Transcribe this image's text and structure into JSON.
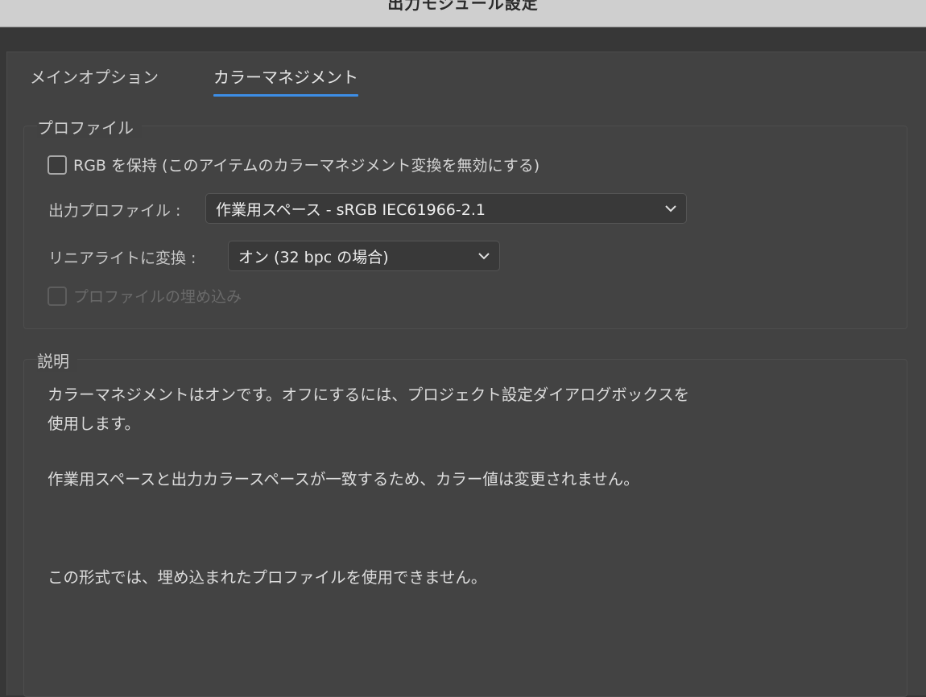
{
  "window": {
    "title": "出力モジュール設定"
  },
  "tabs": [
    {
      "label": "メインオプション",
      "active": false
    },
    {
      "label": "カラーマネジメント",
      "active": true
    }
  ],
  "profile_group": {
    "legend": "プロファイル",
    "preserve_rgb": {
      "label": "RGB を保持 (このアイテムのカラーマネジメント変換を無効にする)",
      "checked": false
    },
    "output_profile": {
      "label": "出力プロファイル :",
      "value": "作業用スペース - sRGB IEC61966-2.1"
    },
    "linear_light": {
      "label": "リニアライトに変換 :",
      "value": "オン (32 bpc の場合)"
    },
    "embed_profile": {
      "label": "プロファイルの埋め込み",
      "checked": false,
      "disabled": true
    }
  },
  "description_group": {
    "legend": "説明",
    "lines": [
      "カラーマネジメントはオンです。オフにするには、プロジェクト設定ダイアログボックスを",
      "使用します。",
      "作業用スペースと出力カラースペースが一致するため、カラー値は変更されません。",
      "この形式では、埋め込まれたプロファイルを使用できません。"
    ]
  },
  "colors": {
    "accent": "#3d8ee6",
    "background": "#424242"
  }
}
